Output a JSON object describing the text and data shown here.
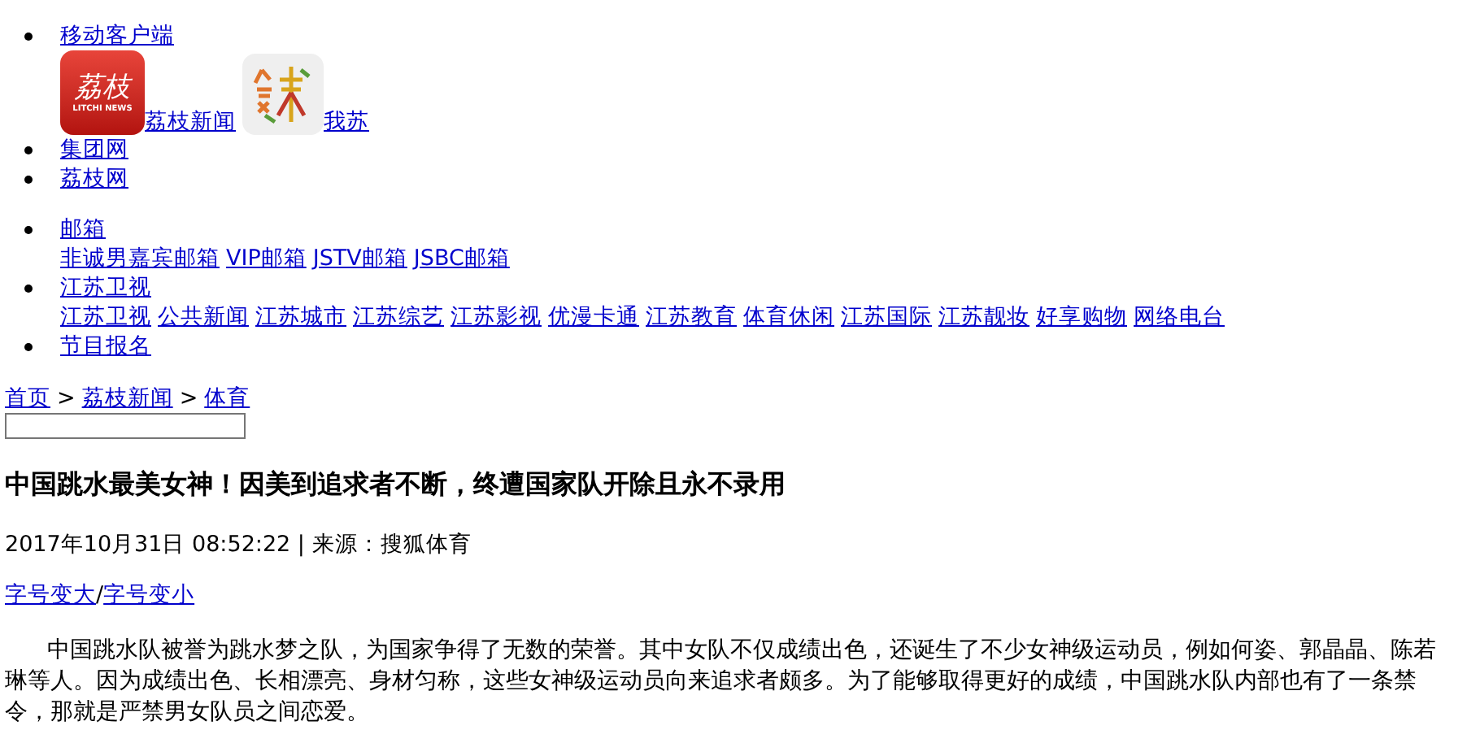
{
  "nav_top": [
    {
      "kind": "apps",
      "label": "移动客户端",
      "apps": [
        {
          "kind": "litchi",
          "logo_text": "荔枝",
          "logo_subtext": "LITCHI NEWS",
          "label": "荔枝新闻"
        },
        {
          "kind": "wosu",
          "label": "我苏"
        }
      ]
    },
    {
      "kind": "link",
      "label": "集团网"
    },
    {
      "kind": "link",
      "label": "荔枝网"
    }
  ],
  "nav_bottom": [
    {
      "label": "邮箱",
      "links": [
        "非诚男嘉宾邮箱",
        "VIP邮箱",
        "JSTV邮箱",
        "JSBC邮箱"
      ]
    },
    {
      "label": "江苏卫视",
      "links": [
        "江苏卫视",
        "公共新闻",
        "江苏城市",
        "江苏综艺",
        "江苏影视",
        "优漫卡通",
        "江苏教育",
        "体育休闲",
        "江苏国际",
        "江苏靓妆",
        "好享购物",
        "网络电台"
      ]
    },
    {
      "label": "节目报名"
    }
  ],
  "breadcrumb": {
    "items": [
      "首页",
      "荔枝新闻",
      "体育"
    ],
    "separator": ">"
  },
  "article": {
    "title": "中国跳水最美女神！因美到追求者不断，终遭国家队开除且永不录用",
    "meta": "2017年10月31日 08:52:22 | 来源：搜狐体育",
    "font_links": [
      "字号变大",
      "字号变小"
    ],
    "font_links_separator": "/",
    "body": "中国跳水队被誉为跳水梦之队，为国家争得了无数的荣誉。其中女队不仅成绩出色，还诞生了不少女神级运动员，例如何姿、郭晶晶、陈若琳等人。因为成绩出色、长相漂亮、身材匀称，这些女神级运动员向来追求者颇多。为了能够取得更好的成绩，中国跳水队内部也有了一条禁令，那就是严禁男女队员之间恋爱。"
  }
}
